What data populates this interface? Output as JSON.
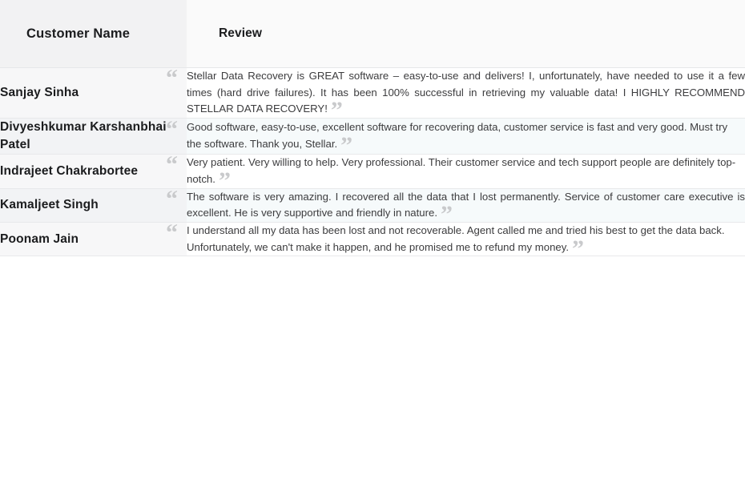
{
  "table": {
    "columns": [
      {
        "key": "customer_name",
        "label": "Customer Name"
      },
      {
        "key": "review",
        "label": "Review"
      }
    ],
    "rows": [
      {
        "customer_name": "Sanjay Sinha",
        "review": "Stellar Data Recovery is GREAT software – easy-to-use and delivers! I, unfortunately, have needed to use it a few times (hard drive failures). It has been 100% successful in retrieving my valuable data! I HIGHLY RECOMMEND STELLAR DATA RECOVERY!",
        "align": "justify"
      },
      {
        "customer_name": "Divyeshkumar Karshanbhai Patel",
        "review": "Good software, easy-to-use, excellent software for recovering data, customer service is fast and very good. Must try the software. Thank you, Stellar.",
        "align": "justify-left"
      },
      {
        "customer_name": "Indrajeet Chakrabortee",
        "review": "Very patient. Very willing to help. Very professional. Their customer service and tech support people are definitely top-notch.",
        "align": "justify-left"
      },
      {
        "customer_name": "Kamaljeet Singh",
        "review": "The software is very amazing. I recovered all the data that I lost permanently. Service of customer care executive is excellent. He is very supportive and friendly in nature.",
        "align": "justify"
      },
      {
        "customer_name": "Poonam Jain",
        "review": "I understand all my data has been lost and not recoverable. Agent called me and tried his best to get the data back. Unfortunately, we can't make it happen, and he promised me to refund my money.",
        "align": "justify-left"
      }
    ]
  },
  "glyphs": {
    "quote_open": "“",
    "quote_close": "”"
  },
  "colors": {
    "text_primary": "#1b1c1e",
    "text_body": "#3c3c3e",
    "quote_mark": "#c9cacc",
    "row_border": "#e8e9eb",
    "header_name_bg": "#f2f2f3",
    "header_review_bg": "#fafafa",
    "stripe_odd_name_bg": "#f7f7f8",
    "stripe_odd_review_bg": "#ffffff",
    "stripe_even_name_bg": "#f2f3f5",
    "stripe_even_review_bg": "#f6fafb"
  }
}
